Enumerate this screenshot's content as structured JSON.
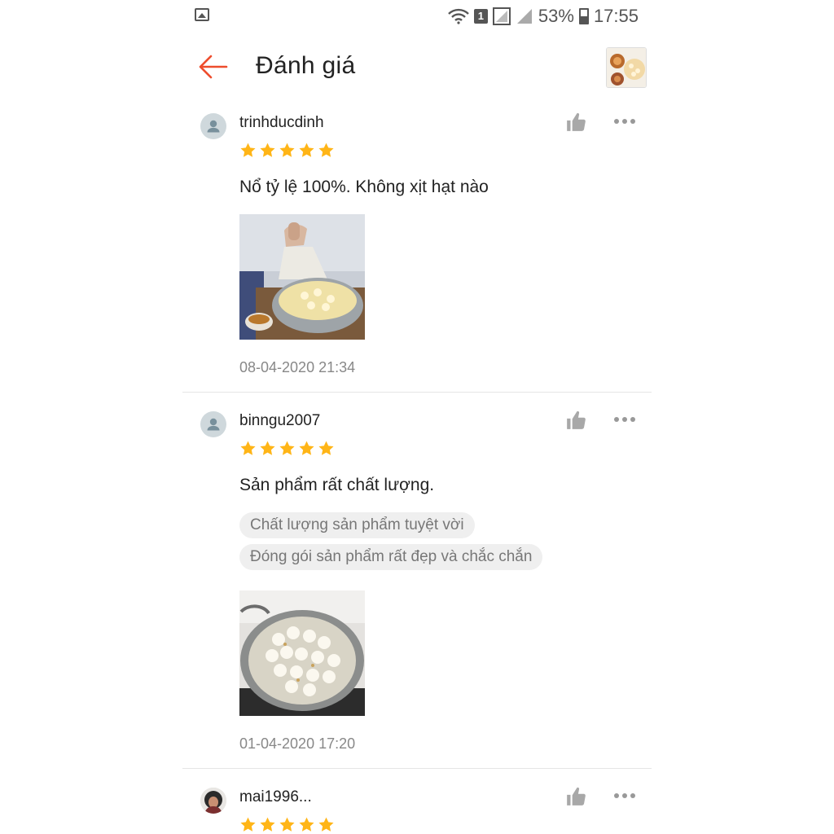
{
  "status_bar": {
    "sim": "1",
    "battery": "53%",
    "time": "17:55"
  },
  "header": {
    "title": "Đánh giá",
    "back_icon": "arrow-left-icon"
  },
  "colors": {
    "accent": "#ee4d2d",
    "star": "#ffb517",
    "date": "#888888",
    "tag_bg": "#efefef"
  },
  "reviews": [
    {
      "username": "trinhducdinh",
      "rating": 5,
      "comment": "Nổ tỷ lệ 100%. Không xịt hạt nào",
      "tags": [],
      "date": "08-04-2020 21:34"
    },
    {
      "username": "binngu2007",
      "rating": 5,
      "comment": "Sản phẩm rất chất lượng.",
      "tags": [
        "Chất lượng sản phẩm tuyệt vời",
        "Đóng gói sản phẩm rất đẹp và chắc chắn"
      ],
      "date": "01-04-2020 17:20"
    },
    {
      "username": "mai1996...",
      "rating": 5
    }
  ]
}
